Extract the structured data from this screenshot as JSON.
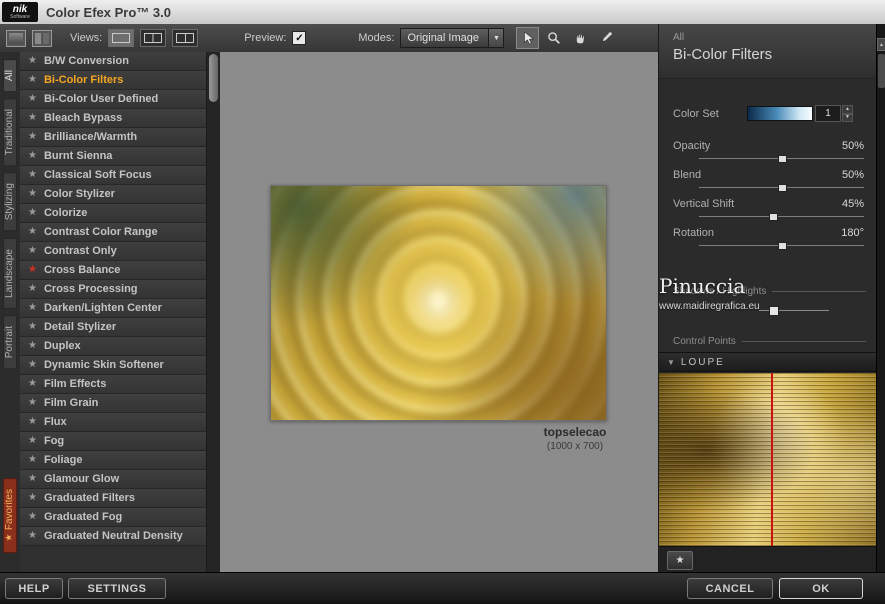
{
  "titlebar": {
    "logo_main": "nik",
    "logo_sub": "Software",
    "title": "Color Efex Pro™ 3.0"
  },
  "toolbar": {
    "views_label": "Views:",
    "preview_label": "Preview:",
    "modes_label": "Modes:",
    "modes_value": "Original Image"
  },
  "icons": {
    "star": "★",
    "check": "✓",
    "dropdown_arrow": "▼",
    "collapse_arrow": "▼",
    "up_arrow": "▲",
    "down_arrow": "▼"
  },
  "side_tabs": [
    "All",
    "Traditional",
    "Stylizing",
    "Landscape",
    "Portrait",
    "Favorites"
  ],
  "filter_list": [
    {
      "name": "B/W Conversion",
      "star_color": "#9a9a9a",
      "selected": false
    },
    {
      "name": "Bi-Color Filters",
      "star_color": "#9a9a9a",
      "selected": true
    },
    {
      "name": "Bi-Color User Defined",
      "star_color": "#9a9a9a",
      "selected": false
    },
    {
      "name": "Bleach Bypass",
      "star_color": "#9a9a9a",
      "selected": false
    },
    {
      "name": "Brilliance/Warmth",
      "star_color": "#9a9a9a",
      "selected": false
    },
    {
      "name": "Burnt Sienna",
      "star_color": "#9a9a9a",
      "selected": false
    },
    {
      "name": "Classical Soft Focus",
      "star_color": "#9a9a9a",
      "selected": false
    },
    {
      "name": "Color Stylizer",
      "star_color": "#9a9a9a",
      "selected": false
    },
    {
      "name": "Colorize",
      "star_color": "#9a9a9a",
      "selected": false
    },
    {
      "name": "Contrast Color Range",
      "star_color": "#9a9a9a",
      "selected": false
    },
    {
      "name": "Contrast Only",
      "star_color": "#9a9a9a",
      "selected": false
    },
    {
      "name": "Cross Balance",
      "star_color": "#cc3322",
      "selected": false
    },
    {
      "name": "Cross Processing",
      "star_color": "#9a9a9a",
      "selected": false
    },
    {
      "name": "Darken/Lighten Center",
      "star_color": "#9a9a9a",
      "selected": false
    },
    {
      "name": "Detail Stylizer",
      "star_color": "#9a9a9a",
      "selected": false
    },
    {
      "name": "Duplex",
      "star_color": "#9a9a9a",
      "selected": false
    },
    {
      "name": "Dynamic Skin Softener",
      "star_color": "#9a9a9a",
      "selected": false
    },
    {
      "name": "Film Effects",
      "star_color": "#9a9a9a",
      "selected": false
    },
    {
      "name": "Film Grain",
      "star_color": "#9a9a9a",
      "selected": false
    },
    {
      "name": "Flux",
      "star_color": "#9a9a9a",
      "selected": false
    },
    {
      "name": "Fog",
      "star_color": "#9a9a9a",
      "selected": false
    },
    {
      "name": "Foliage",
      "star_color": "#9a9a9a",
      "selected": false
    },
    {
      "name": "Glamour Glow",
      "star_color": "#9a9a9a",
      "selected": false
    },
    {
      "name": "Graduated Filters",
      "star_color": "#9a9a9a",
      "selected": false
    },
    {
      "name": "Graduated Fog",
      "star_color": "#9a9a9a",
      "selected": false
    },
    {
      "name": "Graduated Neutral Density",
      "star_color": "#9a9a9a",
      "selected": false
    }
  ],
  "canvas": {
    "caption": "topselecao",
    "size_label": "(1000 x 700)"
  },
  "right_panel": {
    "category": "All",
    "title": "Bi-Color Filters",
    "color_set": {
      "label": "Color Set",
      "value": "1"
    },
    "sliders": [
      {
        "label": "Opacity",
        "value": "50%",
        "fraction": 0.5
      },
      {
        "label": "Blend",
        "value": "50%",
        "fraction": 0.5
      },
      {
        "label": "Vertical Shift",
        "value": "45%",
        "fraction": 0.45
      },
      {
        "label": "Rotation",
        "value": "180°",
        "fraction": 0.5
      }
    ],
    "shadows_label": "Shadows / Highlights",
    "control_points_label": "Control Points",
    "loupe_label": "LOUPE",
    "watermark_line1": "Pinuccia",
    "watermark_line2": "www.maidiregrafica.eu"
  },
  "footer": {
    "help": "HELP",
    "settings": "SETTINGS",
    "cancel": "CANCEL",
    "ok": "OK"
  },
  "colors": {
    "accent": "#f5a623",
    "favorites_tab": "#8a2f1c"
  }
}
